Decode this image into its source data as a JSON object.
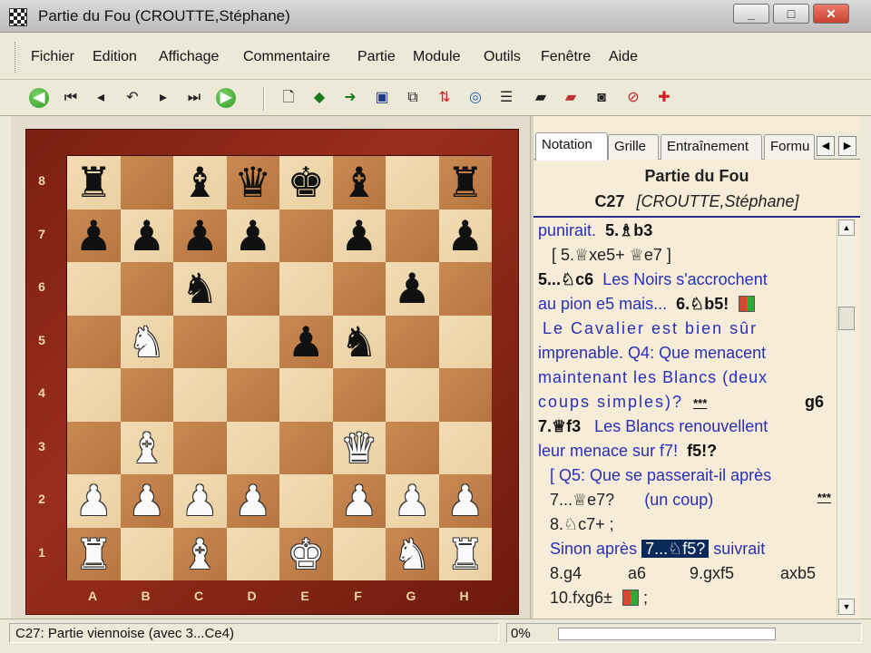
{
  "window": {
    "title": "Partie du Fou  (CROUTTE,Stéphane)"
  },
  "menu": [
    "Fichier",
    "Edition",
    "Affichage",
    "Commentaire",
    "Partie",
    "Module",
    "Outils",
    "Fenêtre",
    "Aide"
  ],
  "toolbar_icons": [
    "back-icon",
    "first-move-icon",
    "prev-move-icon",
    "undo-icon",
    "next-move-icon",
    "last-move-icon",
    "forward-icon",
    "new-document-icon",
    "arrow-left-icon",
    "arrow-right-icon",
    "save-icon",
    "save-all-icon",
    "sort-icon",
    "web-icon",
    "properties-icon",
    "eraser-icon",
    "clear-icon",
    "camera-icon",
    "delete-game-icon",
    "crosshair-icon"
  ],
  "board": {
    "ranks": [
      "8",
      "7",
      "6",
      "5",
      "4",
      "3",
      "2",
      "1"
    ],
    "files": [
      "A",
      "B",
      "C",
      "D",
      "E",
      "F",
      "G",
      "H"
    ],
    "position": [
      [
        "r",
        "",
        "b",
        "q",
        "k",
        "b",
        "",
        "r"
      ],
      [
        "p",
        "p",
        "p",
        "p",
        "",
        "p",
        "",
        "p"
      ],
      [
        "",
        "",
        "n",
        "",
        "",
        "",
        "p",
        ""
      ],
      [
        "",
        "N",
        "",
        "",
        "p",
        "n",
        "",
        ""
      ],
      [
        "",
        "",
        "",
        "",
        "",
        "",
        "",
        ""
      ],
      [
        "",
        "B",
        "",
        "",
        "",
        "Q",
        "",
        ""
      ],
      [
        "P",
        "P",
        "P",
        "P",
        "",
        "P",
        "P",
        "P"
      ],
      [
        "R",
        "",
        "B",
        "",
        "K",
        "",
        "N",
        "R"
      ]
    ]
  },
  "tabs": [
    "Notation",
    "Grille",
    "Entraînement",
    "Formu"
  ],
  "game": {
    "title": "Partie du Fou",
    "eco": "C27",
    "players": "[CROUTTE,Stéphane]"
  },
  "notation": {
    "l1_c": "punirait.",
    "l1_m": "5.♗b3",
    "l2": "[ 5.♕xe5+  ♕e7 ]",
    "l3_m": "5...♘c6",
    "l3_c": "Les Noirs s'accrochent",
    "l4_c": "au pion e5 mais...",
    "l4_m": "6.♘b5!",
    "l5": "Le Cavalier est bien sûr",
    "l6": "imprenable. Q4: Que menacent",
    "l7": "maintenant les Blancs (deux",
    "l8_c": "coups simples)?",
    "l8_s": "***",
    "l8_m": "g6",
    "l9_m": "7.♕f3",
    "l9_c": "Les Blancs renouvellent",
    "l10_c": "leur menace sur f7!",
    "l10_m": "f5!?",
    "l11": "[  Q5: Que se passerait-il après",
    "l12_v": "7...♕e7?",
    "l12_c": "(un coup)",
    "l12_s": "***",
    "l13": "8.♘c7+ ;",
    "l14_c": "Sinon après",
    "l14_sel": "7...♘f5?",
    "l14_c2": "suivrait",
    "l15_a": "8.g4",
    "l15_b": "a6",
    "l15_c": "9.gxf5",
    "l15_d": "axb5",
    "l16": "10.fxg6±",
    "l16_end": ";"
  },
  "status": {
    "text": "C27: Partie viennoise (avec 3...Ce4)",
    "progress_label": "0%",
    "progress": 0
  }
}
